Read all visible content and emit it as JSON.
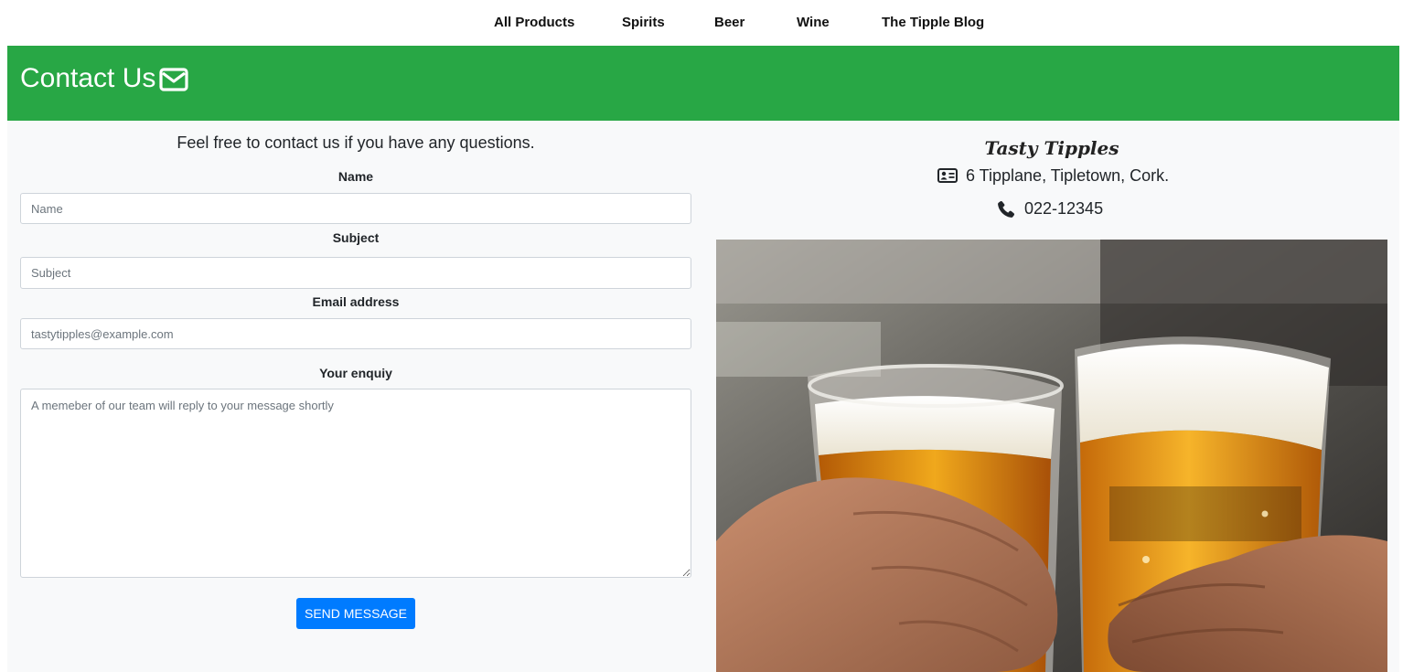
{
  "nav": {
    "items": [
      {
        "label": "All Products"
      },
      {
        "label": "Spirits"
      },
      {
        "label": "Beer"
      },
      {
        "label": "Wine"
      },
      {
        "label": "The Tipple Blog"
      }
    ]
  },
  "banner": {
    "title": "Contact Us",
    "icon": "envelope-icon",
    "color": "#28a745"
  },
  "form": {
    "intro": "Feel free to contact us if you have any questions.",
    "name_label": "Name",
    "name_placeholder": "Name",
    "subject_label": "Subject",
    "subject_placeholder": "Subject",
    "email_label": "Email address",
    "email_placeholder": "tastytipples@example.com",
    "enquiry_label": "Your enquiy",
    "enquiry_placeholder": "A memeber of our team will reply to your message shortly",
    "send_label": "SEND MESSAGE",
    "send_color": "#007bff"
  },
  "store": {
    "name": "Tasty Tipples",
    "address": "6 Tipplane, Tipletown, Cork.",
    "address_icon": "address-card-icon",
    "phone": "022-12345",
    "phone_icon": "phone-icon"
  },
  "photo": {
    "subject": "beer-glasses-toast-image"
  }
}
